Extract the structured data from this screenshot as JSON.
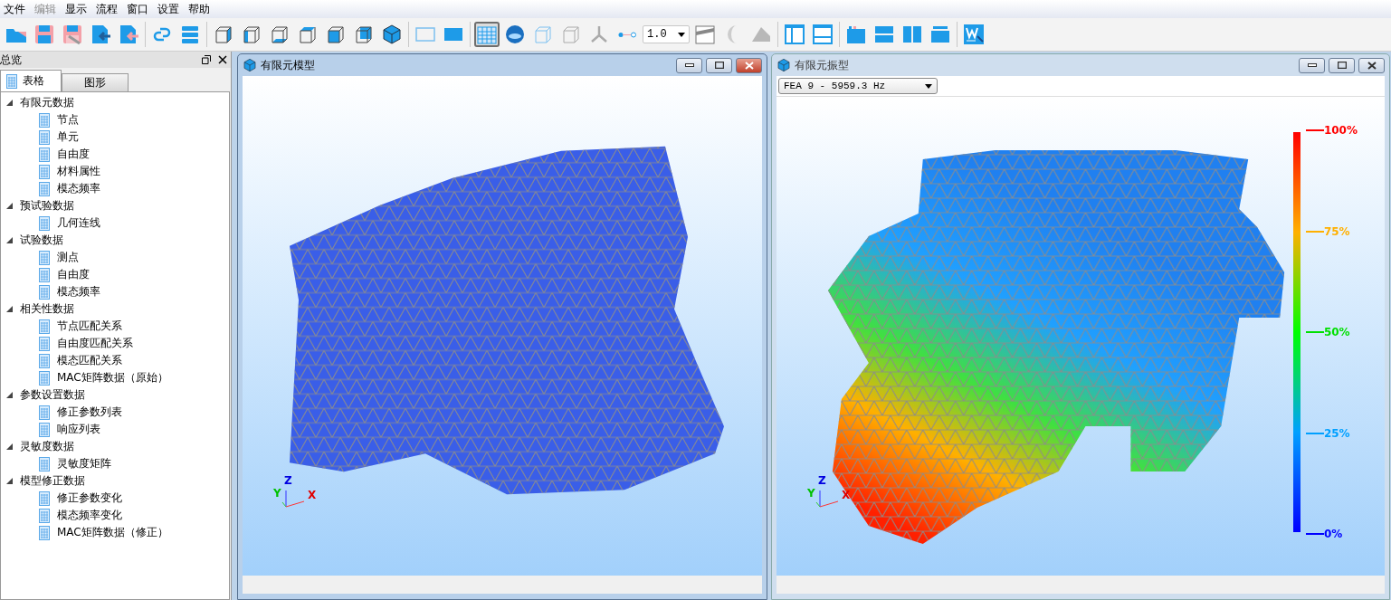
{
  "menu": [
    {
      "label": "文件",
      "disabled": false
    },
    {
      "label": "编辑",
      "disabled": true
    },
    {
      "label": "显示",
      "disabled": false
    },
    {
      "label": "流程",
      "disabled": false
    },
    {
      "label": "窗口",
      "disabled": false
    },
    {
      "label": "设置",
      "disabled": false
    },
    {
      "label": "帮助",
      "disabled": false
    }
  ],
  "toolbar": {
    "groups": [
      [
        {
          "kind": "button",
          "selected": false
        },
        {
          "kind": "button",
          "selected": false
        },
        {
          "kind": "button",
          "selected": false
        },
        {
          "kind": "button",
          "selected": false
        },
        {
          "kind": "button",
          "selected": false
        }
      ],
      [
        {
          "kind": "button",
          "selected": false
        },
        {
          "kind": "button",
          "selected": false
        }
      ],
      [
        {
          "kind": "button",
          "selected": false
        },
        {
          "kind": "button",
          "selected": false
        },
        {
          "kind": "button",
          "selected": false
        },
        {
          "kind": "button",
          "selected": false
        },
        {
          "kind": "button",
          "selected": false
        },
        {
          "kind": "button",
          "selected": false
        },
        {
          "kind": "button",
          "selected": false
        }
      ],
      [
        {
          "kind": "button",
          "selected": false
        },
        {
          "kind": "button",
          "selected": false
        }
      ],
      [
        {
          "kind": "button",
          "selected": true
        },
        {
          "kind": "button",
          "selected": false
        },
        {
          "kind": "button",
          "selected": false
        },
        {
          "kind": "button",
          "selected": false
        },
        {
          "kind": "button",
          "selected": false
        },
        {
          "kind": "button",
          "selected": false
        },
        {
          "kind": "combo",
          "value": "1.0"
        },
        {
          "kind": "button",
          "selected": false
        },
        {
          "kind": "button",
          "selected": false
        },
        {
          "kind": "button",
          "selected": false
        }
      ],
      [
        {
          "kind": "button",
          "selected": false
        },
        {
          "kind": "button",
          "selected": false
        }
      ],
      [
        {
          "kind": "button",
          "selected": false
        },
        {
          "kind": "button",
          "selected": false
        },
        {
          "kind": "button",
          "selected": false
        },
        {
          "kind": "button",
          "selected": false
        }
      ],
      [
        {
          "kind": "button",
          "selected": false
        }
      ]
    ]
  },
  "sidebar": {
    "title": "总览",
    "tabs": [
      {
        "label": "表格",
        "selected": true
      },
      {
        "label": "图形",
        "selected": false
      }
    ],
    "tree": [
      {
        "label": "有限元数据",
        "expanded": true,
        "children": [
          {
            "label": "节点"
          },
          {
            "label": "单元"
          },
          {
            "label": "自由度"
          },
          {
            "label": "材料属性"
          },
          {
            "label": "模态频率"
          }
        ]
      },
      {
        "label": "预试验数据",
        "expanded": true,
        "children": [
          {
            "label": "几何连线"
          }
        ]
      },
      {
        "label": "试验数据",
        "expanded": true,
        "children": [
          {
            "label": "测点"
          },
          {
            "label": "自由度"
          },
          {
            "label": "模态频率"
          }
        ]
      },
      {
        "label": "相关性数据",
        "expanded": true,
        "children": [
          {
            "label": "节点匹配关系"
          },
          {
            "label": "自由度匹配关系"
          },
          {
            "label": "模态匹配关系"
          },
          {
            "label": "MAC矩阵数据（原始）"
          }
        ]
      },
      {
        "label": "参数设置数据",
        "expanded": true,
        "children": [
          {
            "label": "修正参数列表"
          },
          {
            "label": "响应列表"
          }
        ]
      },
      {
        "label": "灵敏度数据",
        "expanded": true,
        "children": [
          {
            "label": "灵敏度矩阵"
          }
        ]
      },
      {
        "label": "模型修正数据",
        "expanded": true,
        "children": [
          {
            "label": "修正参数变化"
          },
          {
            "label": "模态频率变化"
          },
          {
            "label": "MAC矩阵数据（修正）"
          }
        ]
      }
    ]
  },
  "windows": [
    {
      "kind": "model",
      "title": "有限元模型",
      "active": true,
      "axes": {
        "z": "Z",
        "y": "Y",
        "x": "X"
      }
    },
    {
      "kind": "mode_shape",
      "title": "有限元振型",
      "active": false,
      "mode_select": "FEA 9 - 5959.3 Hz",
      "axes": {
        "z": "Z",
        "y": "Y",
        "x": "X"
      },
      "legend": [
        {
          "label": "100%",
          "color": "#ff0000"
        },
        {
          "label": "75%",
          "color": "#ffb000"
        },
        {
          "label": "50%",
          "color": "#00e000"
        },
        {
          "label": "25%",
          "color": "#00a0ff"
        },
        {
          "label": "0%",
          "color": "#0000ff"
        }
      ]
    }
  ]
}
